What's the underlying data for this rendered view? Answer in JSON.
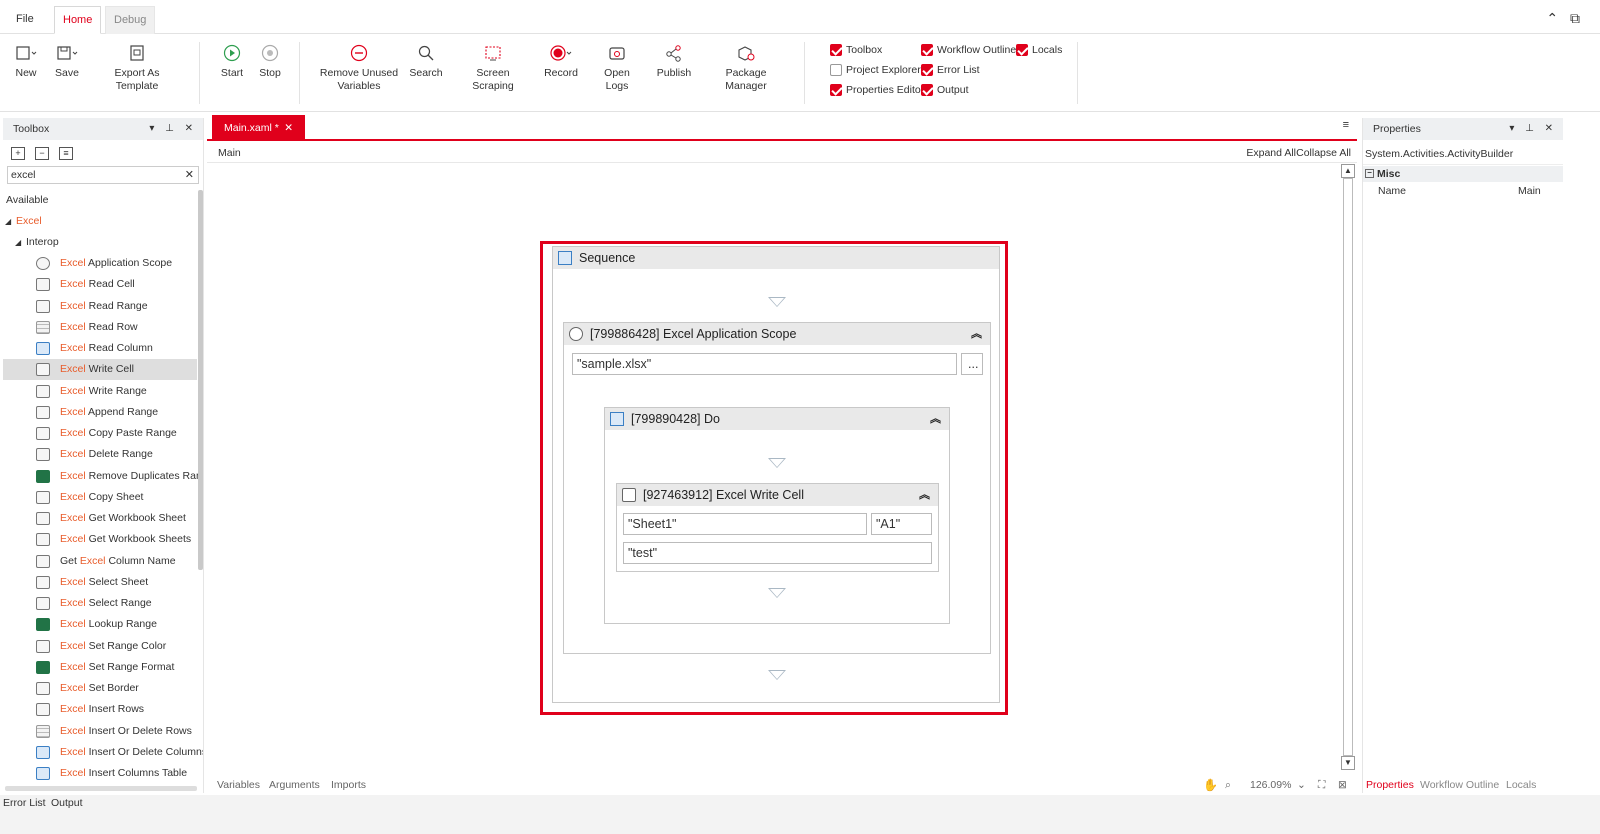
{
  "menu": {
    "file": "File",
    "home": "Home",
    "debug": "Debug"
  },
  "topright": {
    "collapse": "⌃",
    "chat": "⧉"
  },
  "ribbon": {
    "new": "New",
    "save": "Save",
    "export_template": "Export As Template",
    "start": "Start",
    "stop": "Stop",
    "remove_unused_1": "Remove Unused",
    "remove_unused_2": "Variables",
    "search": "Search",
    "screen_scraping": "Screen Scraping",
    "record": "Record",
    "open_logs": "Open Logs",
    "publish": "Publish",
    "package_manager": "Package Manager"
  },
  "panels_toggle": [
    {
      "label": "Toolbox",
      "checked": true
    },
    {
      "label": "Workflow Outline",
      "checked": true
    },
    {
      "label": "Locals",
      "checked": true
    },
    {
      "label": "Project Explorer",
      "checked": false
    },
    {
      "label": "Error List",
      "checked": true
    },
    {
      "label": "Properties Editor",
      "checked": true
    },
    {
      "label": "Output",
      "checked": true
    }
  ],
  "toolbox": {
    "title": "Toolbox",
    "search_value": "excel",
    "available": "Available",
    "group": "Excel",
    "subgroup": "Interop",
    "items": [
      {
        "pre": "",
        "hl": "Excel",
        "post": " Application Scope",
        "icon": "globe"
      },
      {
        "pre": "",
        "hl": "Excel",
        "post": " Read Cell",
        "icon": "cell"
      },
      {
        "pre": "",
        "hl": "Excel",
        "post": " Read Range",
        "icon": "cell"
      },
      {
        "pre": "",
        "hl": "Excel",
        "post": " Read Row",
        "icon": "grid"
      },
      {
        "pre": "",
        "hl": "Excel",
        "post": " Read Column",
        "icon": "blue"
      },
      {
        "pre": "",
        "hl": "Excel",
        "post": " Write Cell",
        "icon": "cell"
      },
      {
        "pre": "",
        "hl": "Excel",
        "post": " Write Range",
        "icon": "cell"
      },
      {
        "pre": "",
        "hl": "Excel",
        "post": " Append Range",
        "icon": "cell"
      },
      {
        "pre": "",
        "hl": "Excel",
        "post": " Copy Paste Range",
        "icon": "cell"
      },
      {
        "pre": "",
        "hl": "Excel",
        "post": " Delete Range",
        "icon": "cell"
      },
      {
        "pre": "",
        "hl": "Excel",
        "post": " Remove Duplicates Range",
        "icon": "green"
      },
      {
        "pre": "",
        "hl": "Excel",
        "post": " Copy Sheet",
        "icon": "cell"
      },
      {
        "pre": "",
        "hl": "Excel",
        "post": " Get Workbook Sheet",
        "icon": "cell"
      },
      {
        "pre": "",
        "hl": "Excel",
        "post": " Get Workbook Sheets",
        "icon": "cell"
      },
      {
        "pre": "Get ",
        "hl": "Excel",
        "post": " Column Name",
        "icon": "cell"
      },
      {
        "pre": "",
        "hl": "Excel",
        "post": " Select Sheet",
        "icon": "cell"
      },
      {
        "pre": "",
        "hl": "Excel",
        "post": " Select Range",
        "icon": "cell"
      },
      {
        "pre": "",
        "hl": "Excel",
        "post": " Lookup Range",
        "icon": "green"
      },
      {
        "pre": "",
        "hl": "Excel",
        "post": " Set Range Color",
        "icon": "cell"
      },
      {
        "pre": "",
        "hl": "Excel",
        "post": " Set Range Format",
        "icon": "green"
      },
      {
        "pre": "",
        "hl": "Excel",
        "post": " Set Border",
        "icon": "cell"
      },
      {
        "pre": "",
        "hl": "Excel",
        "post": " Insert Rows",
        "icon": "cell"
      },
      {
        "pre": "",
        "hl": "Excel",
        "post": " Insert Or Delete Rows",
        "icon": "grid"
      },
      {
        "pre": "",
        "hl": "Excel",
        "post": " Insert Or Delete Columns",
        "icon": "blue"
      },
      {
        "pre": "",
        "hl": "Excel",
        "post": " Insert Columns Table",
        "icon": "blue"
      }
    ]
  },
  "document": {
    "tab_label": "Main.xaml *",
    "breadcrumb": "Main",
    "expand_all": "Expand All",
    "collapse_all": "Collapse All"
  },
  "workflow": {
    "sequence_title": "Sequence",
    "app_scope_title": "[799886428] Excel Application Scope",
    "app_scope_path": "\"sample.xlsx\"",
    "browse_label": "...",
    "do_title": "[799890428] Do",
    "write_cell_title": "[927463912] Excel Write Cell",
    "sheet_value": "\"Sheet1\"",
    "range_value": "\"A1\"",
    "cell_value": "\"test\""
  },
  "doc_bottom": {
    "variables": "Variables",
    "arguments": "Arguments",
    "imports": "Imports",
    "zoom": "126.09%"
  },
  "properties": {
    "title": "Properties",
    "type_name": "System.Activities.ActivityBuilder",
    "category": "Misc",
    "rows": [
      {
        "key": "Name",
        "value": "Main"
      }
    ],
    "tabs": [
      "Properties",
      "Workflow Outline",
      "Locals"
    ]
  },
  "status": {
    "error_list": "Error List",
    "output": "Output"
  },
  "colors": {
    "accent": "#e0001b",
    "highlight": "#e85c2b"
  }
}
